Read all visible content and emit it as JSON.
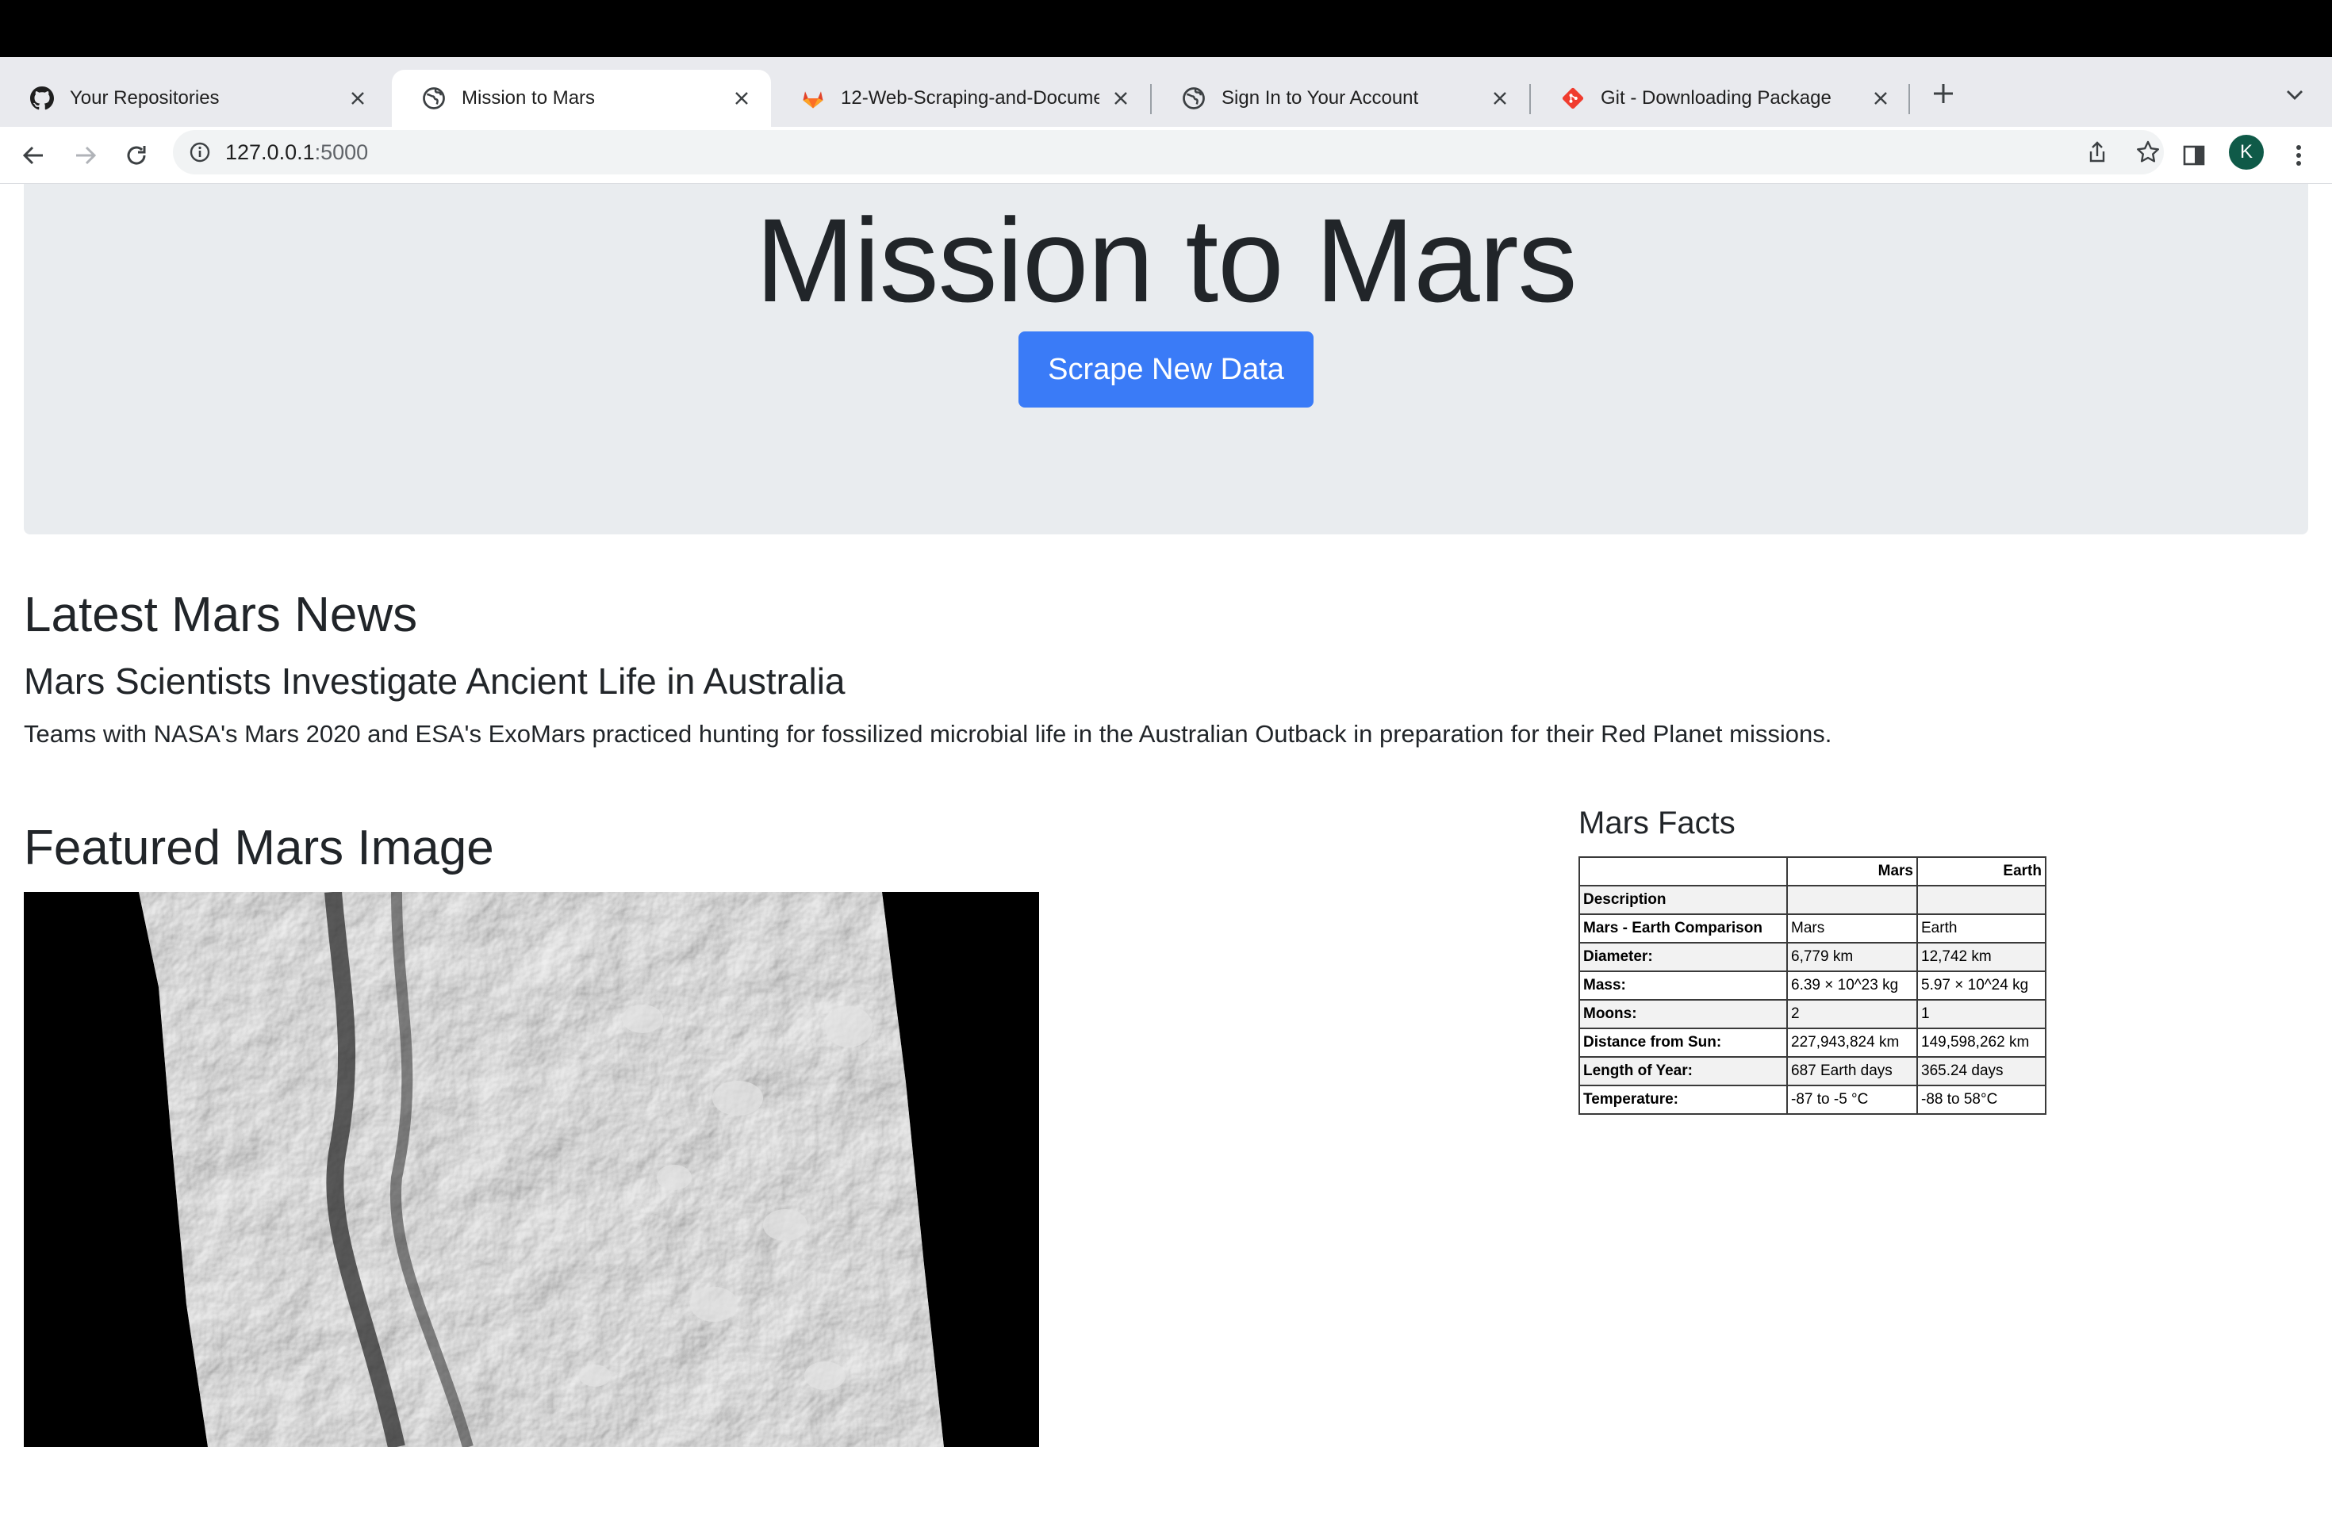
{
  "browser": {
    "tabs": [
      {
        "title": "Your Repositories",
        "icon": "github-icon",
        "active": false
      },
      {
        "title": "Mission to Mars",
        "icon": "globe-icon",
        "active": true
      },
      {
        "title": "12-Web-Scraping-and-Docume",
        "icon": "gitlab-icon",
        "active": false
      },
      {
        "title": "Sign In to Your Account",
        "icon": "globe-icon",
        "active": false
      },
      {
        "title": "Git - Downloading Package",
        "icon": "git-icon",
        "active": false
      }
    ],
    "url_host": "127.0.0.1",
    "url_port": ":5000",
    "profile_initial": "K"
  },
  "page": {
    "title": "Mission to Mars",
    "scrape_button": "Scrape New Data",
    "news_heading": "Latest Mars News",
    "news_title": "Mars Scientists Investigate Ancient Life in Australia",
    "news_paragraph": "Teams with NASA's Mars 2020 and ESA's ExoMars practiced hunting for fossilized microbial life in the Australian Outback in preparation for their Red Planet missions.",
    "image_heading": "Featured Mars Image",
    "facts_heading": "Mars Facts",
    "facts_table": {
      "headers": [
        "",
        "Mars",
        "Earth"
      ],
      "rows": [
        [
          "Description",
          "",
          ""
        ],
        [
          "Mars - Earth Comparison",
          "Mars",
          "Earth"
        ],
        [
          "Diameter:",
          "6,779 km",
          "12,742 km"
        ],
        [
          "Mass:",
          "6.39 × 10^23 kg",
          "5.97 × 10^24 kg"
        ],
        [
          "Moons:",
          "2",
          "1"
        ],
        [
          "Distance from Sun:",
          "227,943,824 km",
          "149,598,262 km"
        ],
        [
          "Length of Year:",
          "687 Earth days",
          "365.24 days"
        ],
        [
          "Temperature:",
          "-87 to -5 °C",
          "-88 to 58°C"
        ]
      ]
    }
  },
  "colors": {
    "primary_button": "#3a7bf7",
    "jumbotron_bg": "#e9ecef",
    "tabstrip_bg": "#e9eaee",
    "avatar_bg": "#0f5a48"
  }
}
